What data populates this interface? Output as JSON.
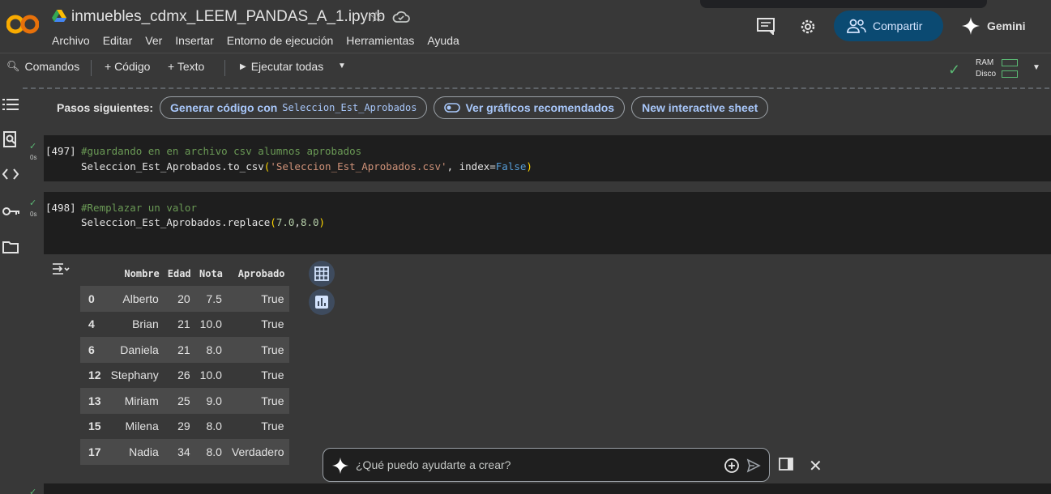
{
  "app": {
    "title": "inmuebles_cdmx_LEEM_PANDAS_A_1.ipynb",
    "logo_text": "CO"
  },
  "menu": [
    "Archivo",
    "Editar",
    "Ver",
    "Insertar",
    "Entorno de ejecución",
    "Herramientas",
    "Ayuda"
  ],
  "header_actions": {
    "share_label": "Compartir",
    "gemini_label": "Gemini"
  },
  "toolbar": {
    "commands": "Comandos",
    "add_code": "+ Código",
    "add_text": "+ Texto",
    "run_all": "Ejecutar todas",
    "ram_label": "RAM",
    "disk_label": "Disco"
  },
  "next_steps": {
    "label": "Pasos siguientes:",
    "chip1_prefix": "Generar código con",
    "chip1_var": "Seleccion_Est_Aprobados",
    "chip2": "Ver gráficos recomendados",
    "chip3": "New interactive sheet"
  },
  "cells": [
    {
      "exec_count": "[497]",
      "time": "0s",
      "line1_comment": "#guardando en en archivo csv alumnos aprobados",
      "line2_pre": "Seleccion_Est_Aprobados.to_csv",
      "line2_str": "'Seleccion_Est_Aprobados.csv'",
      "line2_mid": ", index=",
      "line2_kw": "False"
    },
    {
      "exec_count": "[498]",
      "time": "0s",
      "line1_comment": "#Remplazar un valor",
      "line2_pre": "Seleccion_Est_Aprobados.replace",
      "line2_n1": "7.0",
      "line2_n2": "8.0"
    }
  ],
  "dataframe": {
    "columns": [
      "Nombre",
      "Edad",
      "Nota",
      "Aprobado"
    ],
    "rows": [
      {
        "index": "0",
        "nombre": "Alberto",
        "edad": "20",
        "nota": "7.5",
        "aprobado": "True"
      },
      {
        "index": "4",
        "nombre": "Brian",
        "edad": "21",
        "nota": "10.0",
        "aprobado": "True"
      },
      {
        "index": "6",
        "nombre": "Daniela",
        "edad": "21",
        "nota": "8.0",
        "aprobado": "True"
      },
      {
        "index": "12",
        "nombre": "Stephany",
        "edad": "26",
        "nota": "10.0",
        "aprobado": "True"
      },
      {
        "index": "13",
        "nombre": "Miriam",
        "edad": "25",
        "nota": "9.0",
        "aprobado": "True"
      },
      {
        "index": "15",
        "nombre": "Milena",
        "edad": "29",
        "nota": "8.0",
        "aprobado": "True"
      },
      {
        "index": "17",
        "nombre": "Nadia",
        "edad": "34",
        "nota": "8.0",
        "aprobado": "Verdadero"
      }
    ]
  },
  "prompt": {
    "placeholder": "¿Qué puedo ayudarte a crear?"
  },
  "colors": {
    "accent_share": "#0b4a72",
    "chip_text": "#a8c7fa",
    "ok_green": "#5bb974"
  }
}
